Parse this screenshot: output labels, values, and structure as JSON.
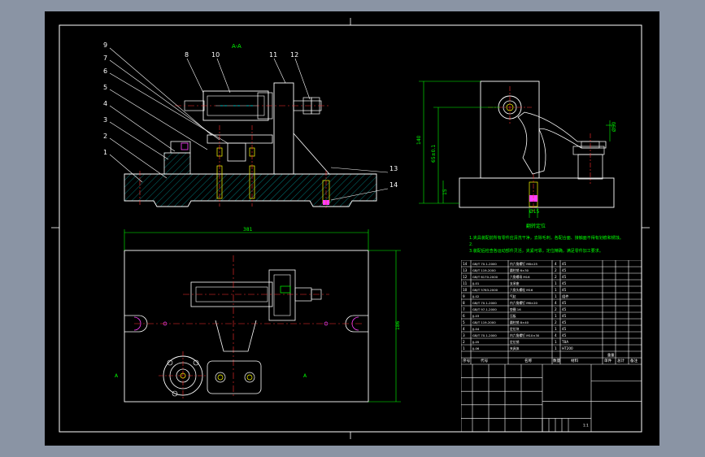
{
  "drawing": {
    "section_label": "A-A",
    "part_numbers_left": [
      "9",
      "7",
      "6",
      "5",
      "4",
      "3",
      "2",
      "1"
    ],
    "part_numbers_top": [
      "8",
      "10",
      "11",
      "12"
    ],
    "part_numbers_right": [
      "13",
      "14"
    ],
    "dim_plan_width": "381",
    "dim_plan_height": "186",
    "dim_side_height": "140",
    "dim_side_inner": "65±0.1",
    "dim_side_small": "15",
    "dim_side_bottom": "Ø15",
    "dim_side_right": "Ø50",
    "note_view_label": "翻转定位",
    "marker_left": "A",
    "marker_right": "A",
    "tech_notes": [
      "1.夹具装配前所有零件应清洗干净，去除毛刺，各配合面、接触面不得有划痕和锈蚀。",
      "2.",
      "3.装配后检查各运动部件灵活，夹紧可靠，定位精确，满足零件加工要求。"
    ]
  },
  "parts_table": {
    "rows": [
      {
        "no": "14",
        "code": "GB/T 70.1-2000",
        "name": "内六角螺钉 M8×25",
        "qty": "4",
        "mat": "45"
      },
      {
        "no": "13",
        "code": "GB/T 119-2000",
        "name": "圆柱销 6×30",
        "qty": "2",
        "mat": "45"
      },
      {
        "no": "12",
        "code": "GB/T 6170-2000",
        "name": "六角螺母 M16",
        "qty": "2",
        "mat": "45"
      },
      {
        "no": "11",
        "code": "JJ-01",
        "name": "支承座",
        "qty": "1",
        "mat": "45"
      },
      {
        "no": "10",
        "code": "GB/T 5783-2000",
        "name": "六角头螺栓 M16",
        "qty": "1",
        "mat": "45"
      },
      {
        "no": "9",
        "code": "JJ-02",
        "name": "气缸",
        "qty": "1",
        "mat": "组件"
      },
      {
        "no": "8",
        "code": "GB/T 70.1-2000",
        "name": "内六角螺钉 M6×20",
        "qty": "4",
        "mat": "45"
      },
      {
        "no": "7",
        "code": "GB/T 97.1-2000",
        "name": "垫圈 16",
        "qty": "2",
        "mat": "45"
      },
      {
        "no": "6",
        "code": "JJ-03",
        "name": "压板",
        "qty": "1",
        "mat": "45"
      },
      {
        "no": "5",
        "code": "GB/T 119-2000",
        "name": "圆柱销 8×40",
        "qty": "2",
        "mat": "45"
      },
      {
        "no": "4",
        "code": "JJ-04",
        "name": "定位块",
        "qty": "1",
        "mat": "45"
      },
      {
        "no": "3",
        "code": "GB/T 70.1-2000",
        "name": "内六角螺钉 M10×30",
        "qty": "4",
        "mat": "45"
      },
      {
        "no": "2",
        "code": "JJ-05",
        "name": "定位销",
        "qty": "1",
        "mat": "T8A"
      },
      {
        "no": "1",
        "code": "JJ-06",
        "name": "夹具体",
        "qty": "1",
        "mat": "HT200"
      }
    ],
    "header": [
      "序号",
      "代号",
      "名称",
      "数量",
      "材料",
      "单件",
      "总计",
      "备注"
    ],
    "sub_header": [
      "重量"
    ],
    "title_block_scale": "1:1"
  },
  "colors": {
    "background": "#000000",
    "frame_bg": "#8a94a4",
    "line": "#ffffff",
    "center": "#ff3030",
    "dim": "#00ff00",
    "cyan": "#00ffff",
    "yellow": "#ffff00",
    "magenta": "#ff40ff",
    "hatch": "#00ffff"
  }
}
